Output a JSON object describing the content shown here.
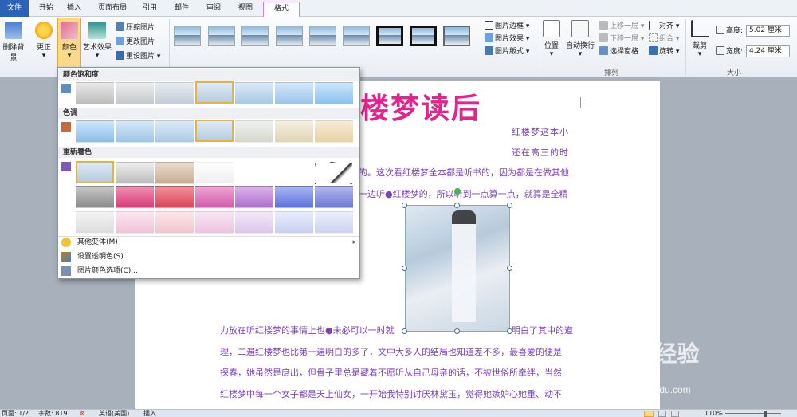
{
  "tabs": [
    "文件",
    "开始",
    "插入",
    "页面布局",
    "引用",
    "邮件",
    "审阅",
    "视图",
    "格式"
  ],
  "ribbon": {
    "remove_bg": "删除背景",
    "correct": "更正",
    "color": "颜色",
    "art_effect": "艺术效果",
    "compress": "压缩图片",
    "change_pic": "更改图片",
    "reset_pic": "重设图片",
    "pic_border": "图片边框",
    "pic_effect": "图片效果",
    "pic_layout": "图片版式",
    "position": "位置",
    "wrap": "自动换行",
    "bring_forward": "上移一层",
    "send_backward": "下移一层",
    "selection_pane": "选择窗格",
    "align": "对齐",
    "group": "组合",
    "rotate": "旋转",
    "crop": "裁剪",
    "height_label": "高度:",
    "height_value": "5.02 厘米",
    "width_label": "宽度:",
    "width_value": "4.24 厘米",
    "arrange_group": "排列",
    "size_group": "大小"
  },
  "dropdown": {
    "saturation": "颜色饱和度",
    "tone": "色调",
    "recolor": "重新着色",
    "more_variants": "其他变体(M)",
    "set_transparent": "设置透明色(S)",
    "color_options": "图片颜色选项(C)..."
  },
  "document": {
    "title": "楼梦读后",
    "lines": [
      "红楼梦这本小",
      "还在高三的时",
      "的。这次看红楼梦全本都是听书的，因为都是在做其他",
      "一边听●红楼梦的，所以听到一点算一点，就算是全精",
      "力放在听红楼梦的事情上也●未必可以一时就",
      "明白了其中的道",
      "理，二遍红楼梦也比第一遍明白的多了，文中大多人的结局也知道差不多，最喜爱的便是",
      "探春，她虽然是庶出，但骨子里总是藏着不愿听从自己母亲的话，不被世俗所牵绊，当然",
      "红楼梦中每一个女子都是天上仙女，一开始我特别讨厌林黛玉，觉得她嫉妒心她重、动不"
    ]
  },
  "status": {
    "page": "页面: 1/2",
    "words": "字数: 819",
    "lang": "英语(美国)",
    "mode": "插入",
    "zoom": "110%"
  },
  "watermark": {
    "main": "Bai 经验",
    "sub": "jingyan.baidu.com"
  },
  "colors": {
    "accent": "#e3248e",
    "text_purple": "#7a44b8",
    "file_tab": "#2a63b8",
    "selection": "#e8b33a"
  }
}
